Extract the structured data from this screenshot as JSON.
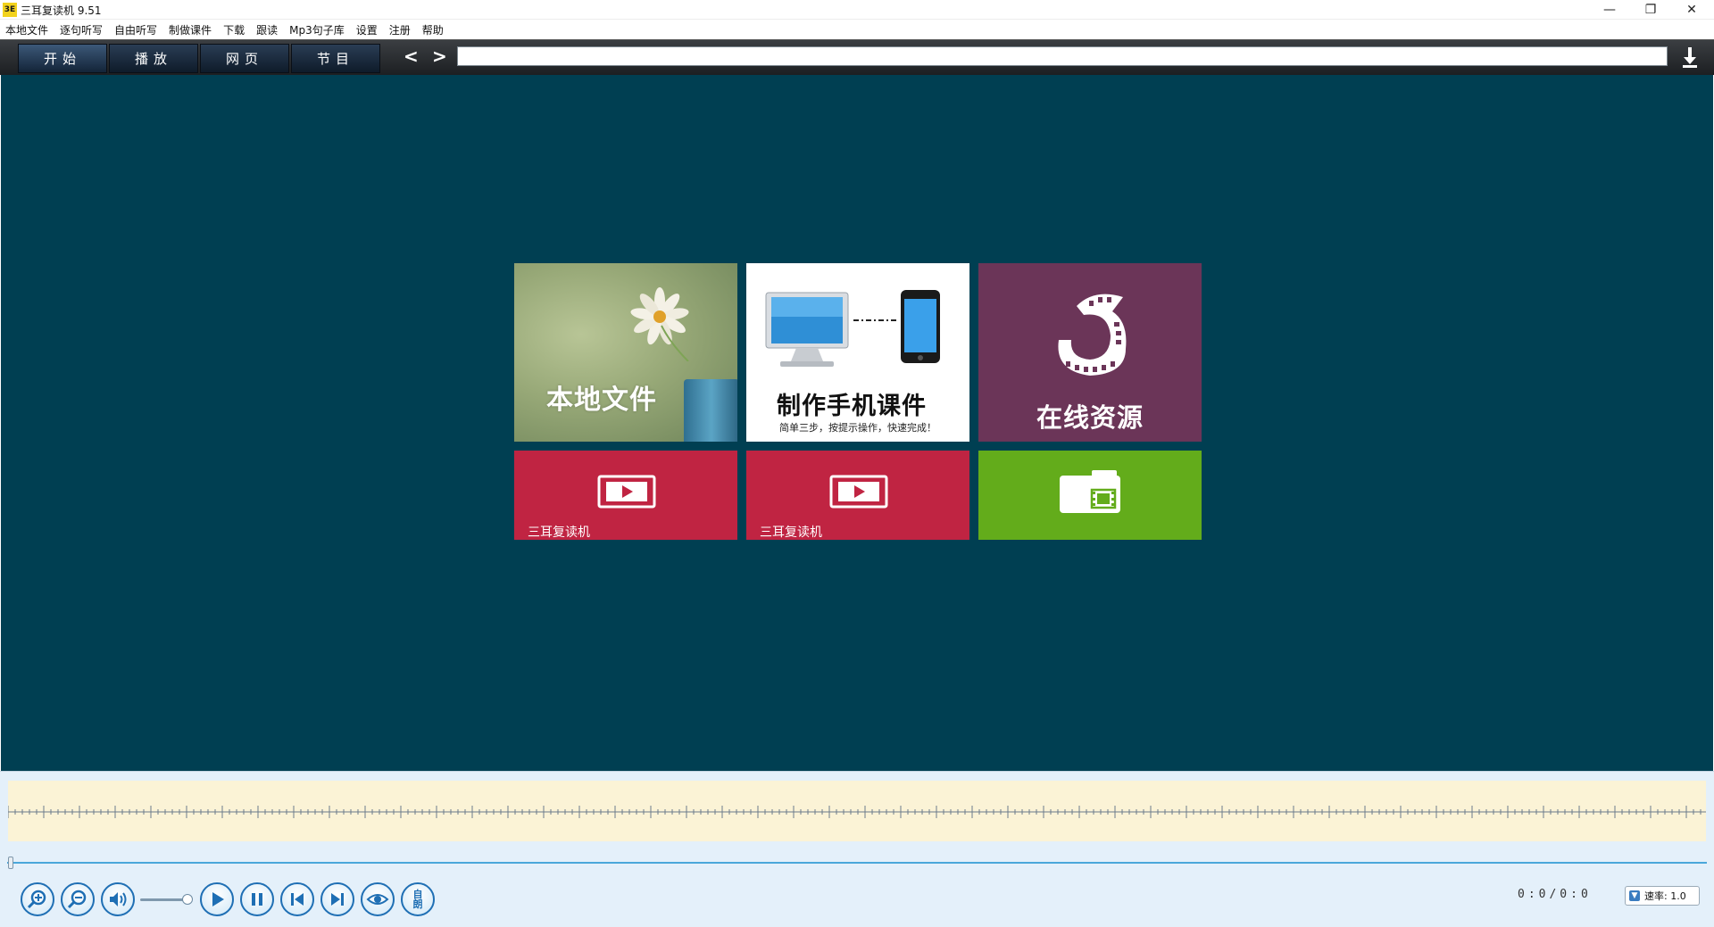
{
  "window": {
    "title": "三耳复读机 9.51",
    "app_icon_text": "3E",
    "minimize_label": "—",
    "restore_label": "❐",
    "close_label": "✕"
  },
  "menu": {
    "items": [
      "本地文件",
      "逐句听写",
      "自由听写",
      "制做课件",
      "下载",
      "跟读",
      "Mp3句子库",
      "设置",
      "注册",
      "帮助"
    ]
  },
  "toolbar": {
    "tabs": [
      "开始",
      "播放",
      "网页",
      "节目"
    ],
    "active_tab_index": 0,
    "back_label": "<",
    "forward_label": ">",
    "url_value": "",
    "download_icon": "download-icon"
  },
  "tiles": {
    "local_file": {
      "label": "本地文件",
      "color": "#9aab7a"
    },
    "mobile_course": {
      "label": "制作手机课件",
      "subtitle": "简单三步，按提示操作，快速完成！",
      "color": "#ffffff"
    },
    "online_resource": {
      "label": "在线资源",
      "color": "#6b3558"
    },
    "video1": {
      "label": "三耳复读机",
      "color": "#c02442"
    },
    "video2": {
      "label": "三耳复读机",
      "color": "#c02442"
    },
    "folder": {
      "label": "",
      "color": "#63ac1b"
    }
  },
  "player": {
    "time_display": "0:0/0:0",
    "rate_label": "速率: 1.0",
    "volume_level": 0.8,
    "progress": 0,
    "controls": [
      "zoom-in-icon",
      "zoom-out-icon",
      "volume-icon",
      "play-icon",
      "pause-icon",
      "previous-icon",
      "next-icon",
      "eye-icon",
      "auto-read-icon"
    ],
    "auto_read_label": "自朗"
  },
  "colors": {
    "main_background": "#003f52",
    "toolbar_background": "#2b2e32",
    "waveform_background": "#fbf3d6",
    "accent": "#1f6fb4"
  }
}
